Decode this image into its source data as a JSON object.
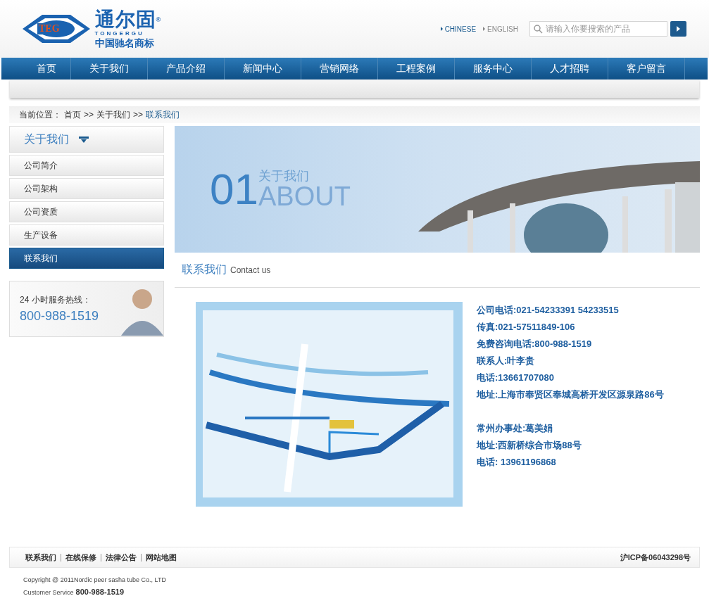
{
  "logo": {
    "badge": "TEG",
    "name": "通尔固",
    "mark": "®",
    "latin": "TONGERGU",
    "slogan": "中国驰名商标"
  },
  "languages": [
    {
      "label": "CHINESE",
      "selected": true
    },
    {
      "label": "ENGLISH",
      "selected": false
    }
  ],
  "search": {
    "placeholder": "请输入你要搜索的产品"
  },
  "nav": [
    "首页",
    "关于我们",
    "产品介绍",
    "新闻中心",
    "营销网络",
    "工程案例",
    "服务中心",
    "人才招聘",
    "客户留言"
  ],
  "breadcrumb": {
    "label": "当前位置：",
    "separator": ">>",
    "items": [
      {
        "label": "首页",
        "current": false
      },
      {
        "label": "关于我们",
        "current": false
      },
      {
        "label": "联系我们",
        "current": true
      }
    ]
  },
  "sidebar": {
    "title": "关于我们",
    "items": [
      {
        "label": "公司简介",
        "selected": false
      },
      {
        "label": "公司架构",
        "selected": false
      },
      {
        "label": "公司资质",
        "selected": false
      },
      {
        "label": "生产设备",
        "selected": false
      },
      {
        "label": "联系我们",
        "selected": true
      }
    ]
  },
  "hotline": {
    "label": "24 小时服务热线：",
    "number": "800-988-1519"
  },
  "banner": {
    "number": "01",
    "title": "关于我们",
    "subtitle": "ABOUT"
  },
  "section": {
    "title": "联系我们",
    "subtitle": "Contact us"
  },
  "contact_groups": [
    [
      "公司电话:021-54233391 54233515",
      "传真:021-57511849-106",
      "免费咨询电话:800-988-1519",
      "联系人:叶李贵",
      "电话:13661707080",
      "地址:上海市奉贤区奉城高桥开发区源泉路86号"
    ],
    [
      "常州办事处:葛美娟",
      "地址:西新桥综合市场88号",
      "电话: 13961196868"
    ]
  ],
  "footer": {
    "links": [
      "联系我们",
      "在线保修",
      "法律公告",
      "网站地图"
    ],
    "icp": "沪ICP备06043298号",
    "copyright": "Copyright @ 2011Nordic peer sasha tube Co., LTD",
    "service_label": "Customer Service",
    "service_number": "800-988-1519"
  }
}
